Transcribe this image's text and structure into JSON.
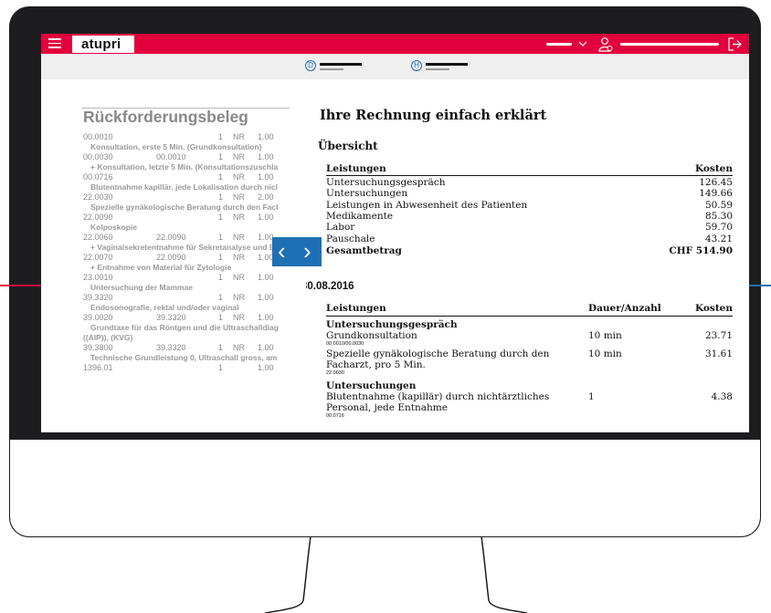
{
  "app": {
    "logo": "atupri",
    "menu_icon": "hamburger-icon",
    "logout_icon": "logout-icon",
    "user_icon": "user-icon"
  },
  "subnav": {
    "icon_d": "D",
    "icon_h": "H"
  },
  "scan": {
    "title": "Rückforderungsbeleg",
    "rows": [
      {
        "code": "00.0010",
        "ref": "",
        "qty": "1",
        "unit": "NR",
        "val": "1.00",
        "desc": "Konsultation, erste 5 Min. (Grundkonsultation)"
      },
      {
        "code": "00.0030",
        "ref": "00.0010",
        "qty": "1",
        "unit": "NR",
        "val": "1.00",
        "desc": "+ Konsultation, letzte 5 Min. (Konsultationszuschla"
      },
      {
        "code": "00.0716",
        "ref": "",
        "qty": "1",
        "unit": "NR",
        "val": "1.00",
        "desc": "Blutentnahme kapillär, jede Lokalisation durch nicl"
      },
      {
        "code": "22.0030",
        "ref": "",
        "qty": "1",
        "unit": "NR",
        "val": "2.00",
        "desc": "Spezielle gynäkologische Beratung durch den Facl"
      },
      {
        "code": "22.0090",
        "ref": "",
        "qty": "1",
        "unit": "NR",
        "val": "1.00",
        "desc": "Kolposkopie"
      },
      {
        "code": "22.0060",
        "ref": "22.0090",
        "qty": "1",
        "unit": "NR",
        "val": "1.00",
        "desc": "+ Vaginalsekretentnahme für Sekretanalyse und Ba"
      },
      {
        "code": "22.0070",
        "ref": "22.0090",
        "qty": "1",
        "unit": "NR",
        "val": "1.00",
        "desc": "+ Entnahme von Material für Zytologie"
      },
      {
        "code": "23.0010",
        "ref": "",
        "qty": "1",
        "unit": "NR",
        "val": "1.00",
        "desc": "Untersuchung der Mammae"
      },
      {
        "code": "39.3320",
        "ref": "",
        "qty": "1",
        "unit": "NR",
        "val": "1.00",
        "desc": "Endosonografie, rektal und/oder vaginal"
      },
      {
        "code": "39.0020",
        "ref": "39.3320",
        "qty": "1",
        "unit": "NR",
        "val": "1.00",
        "desc": "Grundtaxe für das Röntgen und die Ultraschalldiag"
      },
      {
        "code": "",
        "ref": "",
        "qty": "",
        "unit": "",
        "val": "",
        "desc": "((AIP)), (KVG)"
      },
      {
        "code": "39.3800",
        "ref": "39.3320",
        "qty": "1",
        "unit": "NR",
        "val": "1.00",
        "desc": "Technische Grundleistung 0, Ultraschall gross, am"
      },
      {
        "code": "1396.01",
        "ref": "",
        "qty": "1",
        "unit": "",
        "val": "1.00",
        "desc": ""
      }
    ]
  },
  "explain": {
    "title": "Ihre Rechnung einfach erklärt",
    "overview_title": "Übersicht",
    "overview_header": {
      "left": "Leistungen",
      "right": "Kosten"
    },
    "overview_rows": [
      {
        "label": "Untersuchungsgespräch",
        "value": "126.45"
      },
      {
        "label": "Untersuchungen",
        "value": "149.66"
      },
      {
        "label": "Leistungen in Abwesenheit des Patienten",
        "value": "50.59"
      },
      {
        "label": "Medikamente",
        "value": "85.30"
      },
      {
        "label": "Labor",
        "value": "59.70"
      },
      {
        "label": "Pauschale",
        "value": "43.21"
      }
    ],
    "total": {
      "label": "Gesamtbetrag",
      "value": "CHF 514.90"
    },
    "date": "30.08.2016",
    "detail_header": {
      "a": "Leistungen",
      "b": "Dauer/Anzahl",
      "c": "Kosten"
    },
    "groups": [
      {
        "title": "Untersuchungsgespräch",
        "items": [
          {
            "label": "Grundkonsultation",
            "code": "00.0010/00.0030",
            "dur": "10 min",
            "cost": "23.71"
          },
          {
            "label": "Spezielle gynäkologische Beratung durch den Facharzt, pro 5 Min.",
            "code": "22.0030",
            "dur": "10 min",
            "cost": "31.61"
          }
        ]
      },
      {
        "title": "Untersuchungen",
        "items": [
          {
            "label": "Blutentnahme (kapillär) durch nichtärztliches Personal, jede Entnahme",
            "code": "00.0716",
            "dur": "1",
            "cost": "4.38"
          }
        ]
      }
    ]
  },
  "slider": {
    "prev": "‹",
    "next": "›"
  }
}
